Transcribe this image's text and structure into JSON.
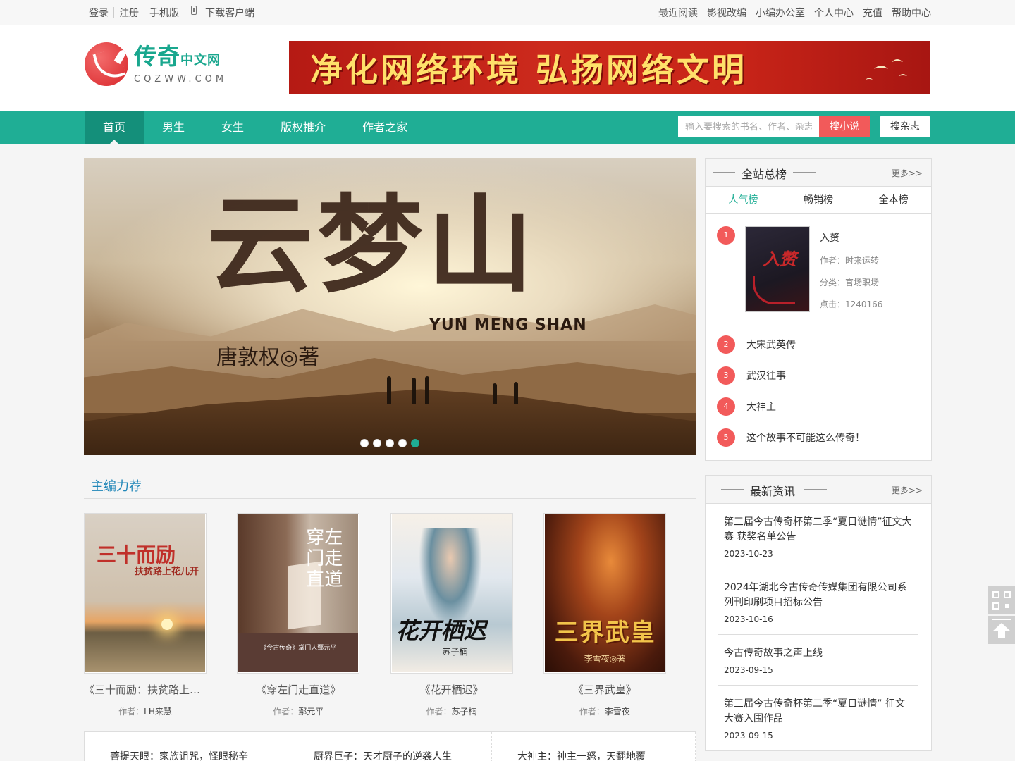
{
  "topbar": {
    "login": "登录",
    "register": "注册",
    "mobile": "手机版",
    "download": "下载客户端",
    "links": [
      "最近阅读",
      "影视改编",
      "小编办公室",
      "个人中心",
      "充值",
      "帮助中心"
    ]
  },
  "header": {
    "logo_text": "传奇",
    "logo_sub": "中文网",
    "logo_url": "CQZWW.COM",
    "banner_text": "净化网络环境  弘扬网络文明"
  },
  "nav": {
    "items": [
      "首页",
      "男生",
      "女生",
      "版权推介",
      "作者之家"
    ],
    "search_placeholder": "输入要搜索的书名、作者、杂志",
    "search_button": "搜小说",
    "magazine_button": "搜杂志"
  },
  "slider": {
    "title": "云梦山",
    "title_en": "YUN MENG SHAN",
    "author": "唐敦权◎著",
    "dots": 5,
    "active_dot": 5
  },
  "recommend": {
    "title": "主编力荐",
    "author_prefix": "作者：",
    "books": [
      {
        "name": "《三十而励：扶贫路上花儿开》",
        "author": "LH来慧",
        "cover_title": "三十而励",
        "cover_sub": "扶贫路上花儿开"
      },
      {
        "name": "《穿左门走直道》",
        "author": "鄢元平",
        "cover_title": "穿左门走直道",
        "cover_sub": "《今古传奇》掌门人鄢元平"
      },
      {
        "name": "《花开栖迟》",
        "author": "苏子楠",
        "cover_title": "花开栖迟",
        "cover_sub": "苏子楠"
      },
      {
        "name": "《三界武皇》",
        "author": "李雪夜",
        "cover_title": "三界武皇",
        "cover_sub": "李雪夜◎著"
      }
    ]
  },
  "bottom_list": [
    "菩提天眼：家族诅咒，怪眼秘辛",
    "厨界巨子：天才厨子的逆袭人生",
    "大神主：神主一怒，天翻地覆"
  ],
  "ranking": {
    "title": "全站总榜",
    "more": "更多>>",
    "tabs": [
      "人气榜",
      "畅销榜",
      "全本榜"
    ],
    "top": {
      "num": "1",
      "name": "入赘",
      "cover_title": "入赘",
      "author_line": "作者：时来运转",
      "category_line": "分类：官场职场",
      "clicks_line": "点击：1240166"
    },
    "rows": [
      {
        "num": "2",
        "name": "大宋武英传"
      },
      {
        "num": "3",
        "name": "武汉往事"
      },
      {
        "num": "4",
        "name": "大神主"
      },
      {
        "num": "5",
        "name": "这个故事不可能这么传奇！"
      }
    ]
  },
  "news": {
    "title": "最新资讯",
    "more": "更多>>",
    "items": [
      {
        "title": "第三届今古传奇杯第二季“夏日谜情”征文大赛 获奖名单公告",
        "date": "2023-10-23"
      },
      {
        "title": "2024年湖北今古传奇传媒集团有限公司系列刊印刷项目招标公告",
        "date": "2023-10-16"
      },
      {
        "title": "今古传奇故事之声上线",
        "date": "2023-09-15"
      },
      {
        "title": "第三届今古传奇杯第二季“夏日谜情” 征文大赛入围作品",
        "date": "2023-09-15"
      }
    ]
  },
  "colors": {
    "brand": "#1fae95",
    "accent": "#f25a5a",
    "link_blue": "#1f86b8"
  }
}
